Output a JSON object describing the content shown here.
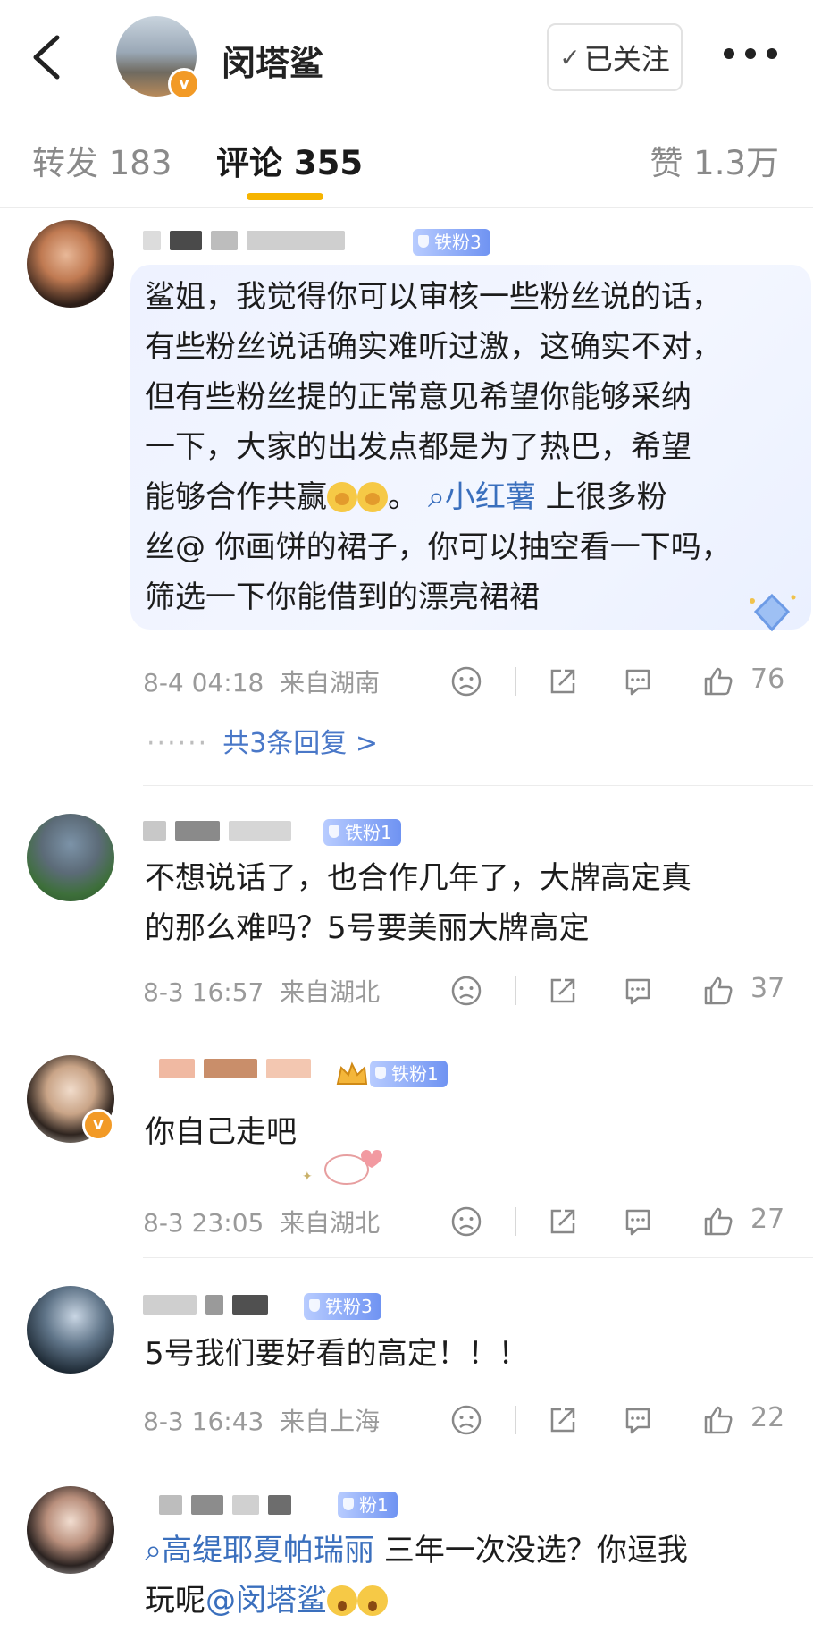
{
  "header": {
    "account_name": "闵塔鲨",
    "follow_label": "已关注",
    "verified_mark": "v"
  },
  "tabs": {
    "repost": "转发 183",
    "comments": "评论 355",
    "likes": "赞 1.3万"
  },
  "comments": [
    {
      "badge": "铁粉3",
      "lines": [
        "鲨姐，我觉得你可以审核一些粉丝说的话，",
        "有些粉丝说话确实难听过激，这确实不对，",
        "但有些粉丝提的正常意见希望你能够采纳",
        "一下，大家的出发点都是为了热巴，希望"
      ],
      "line5_pre": "能够合作共赢",
      "line5_mid": "。",
      "line5_link": "小红薯",
      "line5_post": " 上很多粉",
      "lines_tail": [
        "丝@ 你画饼的裙子，你可以抽空看一下吗，",
        "筛选一下你能借到的漂亮裙裙"
      ],
      "date": "8-4 04:18",
      "location": "来自湖南",
      "likes": "76",
      "replies": "共3条回复 >",
      "replies_dots": "······"
    },
    {
      "badge": "铁粉1",
      "lines": [
        "不想说话了，也合作几年了，大牌高定真",
        "的那么难吗？5号要美丽大牌高定"
      ],
      "date": "8-3 16:57",
      "location": "来自湖北",
      "likes": "37"
    },
    {
      "badge": "铁粉1",
      "lines": [
        "你自己走吧"
      ],
      "date": "8-3 23:05",
      "location": "来自湖北",
      "likes": "27"
    },
    {
      "badge": "铁粉3",
      "lines": [
        "5号我们要好看的高定！！！"
      ],
      "date": "8-3 16:43",
      "location": "来自上海",
      "likes": "22"
    },
    {
      "badge": "粉1",
      "link": "高缇耶夏帕瑞丽",
      "line1_post": " 三年一次没选？你逗我",
      "line2_pre": "玩呢",
      "mention": "@闵塔鲨"
    }
  ]
}
